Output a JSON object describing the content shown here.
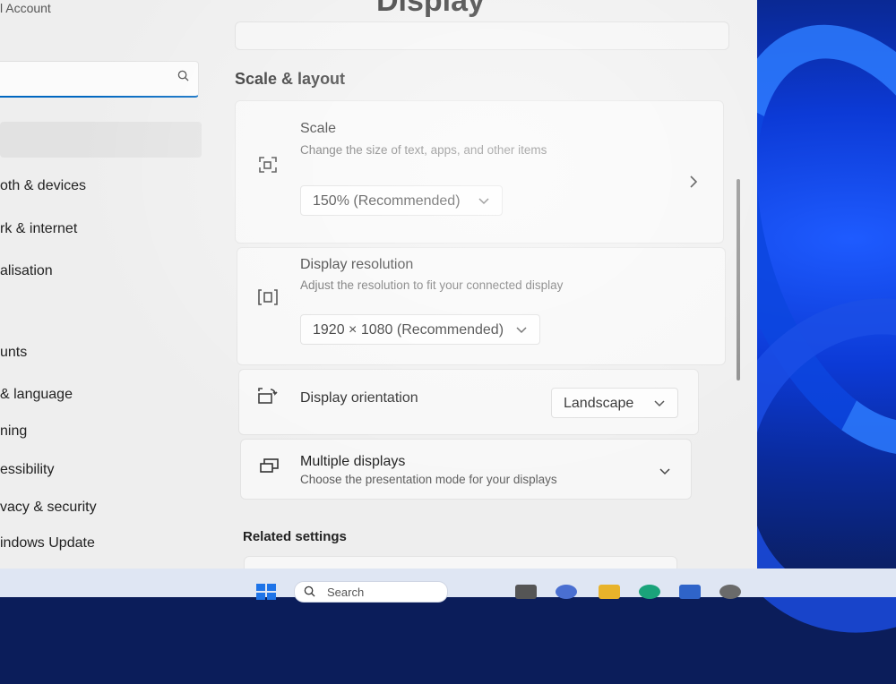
{
  "window": {
    "account_text": "l Account",
    "page_title": "Display"
  },
  "sidebar": {
    "search_placeholder": "",
    "items": [
      {
        "label": "oth & devices"
      },
      {
        "label": "rk & internet"
      },
      {
        "label": "alisation"
      },
      {
        "label": "unts"
      },
      {
        "label": "& language"
      },
      {
        "label": "ning"
      },
      {
        "label": "essibility"
      },
      {
        "label": "vacy & security"
      },
      {
        "label": "indows Update"
      }
    ]
  },
  "main": {
    "section_heading": "Scale & layout",
    "scale": {
      "title": "Scale",
      "description": "Change the size of text, apps, and other items",
      "value": "150% (Recommended)"
    },
    "resolution": {
      "title": "Display resolution",
      "description": "Adjust the resolution to fit your connected display",
      "value": "1920 × 1080 (Recommended)"
    },
    "orientation": {
      "title": "Display orientation",
      "value": "Landscape"
    },
    "multiple_displays": {
      "title": "Multiple displays",
      "description": "Choose the presentation mode for your displays"
    },
    "related_heading": "Related settings"
  },
  "taskbar": {
    "search_label": "Search"
  },
  "icons": {
    "search": "search-icon",
    "scale": "scale-icon",
    "resolution": "resolution-icon",
    "orientation": "orientation-icon",
    "multiple_displays": "multiple-displays-icon",
    "chevron_right": "chevron-right-icon",
    "chevron_down": "chevron-down-icon",
    "windows": "windows-start-icon"
  },
  "colors": {
    "accent": "#0067c0",
    "wallpaper": "#0c3ad6"
  }
}
